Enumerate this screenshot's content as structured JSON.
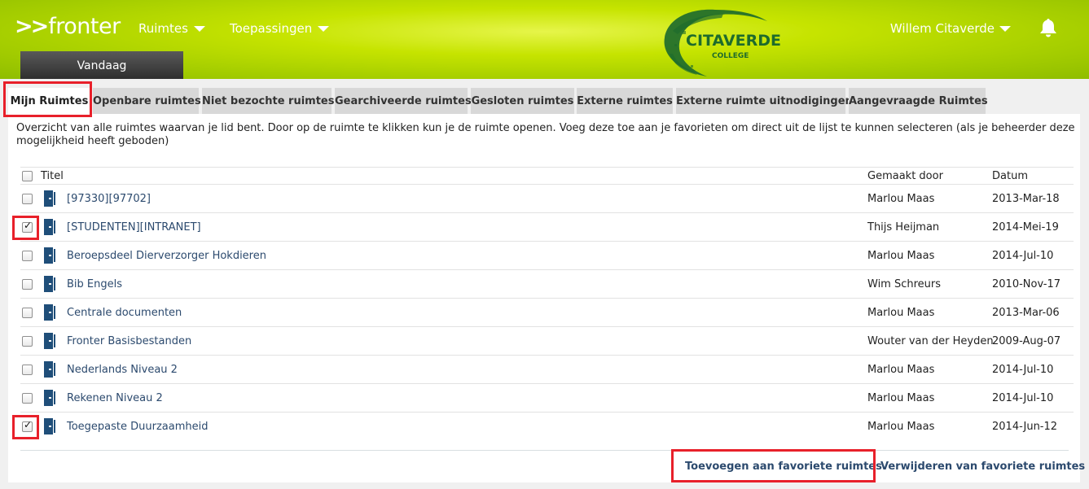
{
  "header": {
    "logo_arrows": ">>",
    "logo_text": "fronter",
    "nav": {
      "ruimtes": "Ruimtes",
      "toepassingen": "Toepassingen"
    },
    "brand": {
      "name": "CITAVERDE",
      "sub": "COLLEGE"
    },
    "user_name": "Willem Citaverde",
    "today_tab": "Vandaag"
  },
  "tabs": [
    {
      "label": "Mijn Ruimtes",
      "active": true
    },
    {
      "label": "Openbare ruimtes"
    },
    {
      "label": "Niet bezochte ruimtes"
    },
    {
      "label": "Gearchiveerde ruimtes"
    },
    {
      "label": "Gesloten ruimtes"
    },
    {
      "label": "Externe ruimtes"
    },
    {
      "label": "Externe ruimte uitnodigingen"
    },
    {
      "label": "Aangevraagde Ruimtes"
    }
  ],
  "intro": "Overzicht van alle ruimtes waarvan je lid bent. Door op de ruimte te klikken kun je de ruimte openen. Voeg deze toe aan je favorieten om direct uit de lijst te kunnen selecteren (als je beheerder deze mogelijkheid heeft geboden)",
  "table": {
    "headers": {
      "title": "Titel",
      "created_by": "Gemaakt door",
      "date": "Datum"
    },
    "rows": [
      {
        "title": "[97330][97702]",
        "created_by": "Marlou Maas",
        "date": "2013-Mar-18",
        "checked": false
      },
      {
        "title": "[STUDENTEN][INTRANET]",
        "created_by": "Thijs Heijman",
        "date": "2014-Mei-19",
        "checked": true
      },
      {
        "title": "Beroepsdeel Dierverzorger Hokdieren",
        "created_by": "Marlou Maas",
        "date": "2014-Jul-10",
        "checked": false
      },
      {
        "title": "Bib Engels",
        "created_by": "Wim Schreurs",
        "date": "2010-Nov-17",
        "checked": false
      },
      {
        "title": "Centrale documenten",
        "created_by": "Marlou Maas",
        "date": "2013-Mar-06",
        "checked": false
      },
      {
        "title": "Fronter Basisbestanden",
        "created_by": "Wouter van der Heyden",
        "date": "2009-Aug-07",
        "checked": false
      },
      {
        "title": "Nederlands Niveau 2",
        "created_by": "Marlou Maas",
        "date": "2014-Jul-10",
        "checked": false
      },
      {
        "title": "Rekenen Niveau 2",
        "created_by": "Marlou Maas",
        "date": "2014-Jul-10",
        "checked": false
      },
      {
        "title": "Toegepaste Duurzaamheid",
        "created_by": "Marlou Maas",
        "date": "2014-Jun-12",
        "checked": true
      }
    ]
  },
  "actions": {
    "add_favorites": "Toevoegen aan favoriete ruimtes",
    "remove_favorites": "Verwijderen van favoriete ruimtes"
  },
  "colors": {
    "header_green": "#a7cf00",
    "link_blue": "#2c4a6e",
    "highlight_red": "#e8202a",
    "icon_blue": "#1f4e79"
  }
}
